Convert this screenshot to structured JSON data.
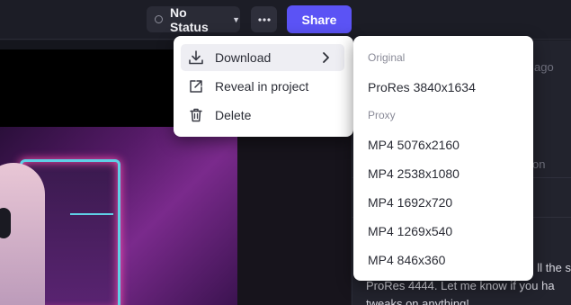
{
  "header": {
    "status_label": "No Status",
    "share_label": "Share"
  },
  "context_menu": {
    "items": [
      {
        "label": "Download",
        "icon": "download-icon"
      },
      {
        "label": "Reveal in project",
        "icon": "external-link-icon"
      },
      {
        "label": "Delete",
        "icon": "trash-icon"
      }
    ]
  },
  "download_submenu": {
    "original_heading": "Original",
    "original_items": [
      "ProRes 3840x1634"
    ],
    "proxy_heading": "Proxy",
    "proxy_items": [
      "MP4 5076x2160",
      "MP4 2538x1080",
      "MP4 1692x720",
      "MP4 1269x540",
      "MP4 846x360"
    ]
  },
  "side_panel": {
    "time_1": "ago",
    "time_2": "on",
    "comment_lines": [
      "ll the s",
      "ProRes 4444. Let me know if you ha",
      "tweaks on anything!"
    ]
  },
  "colors": {
    "accent": "#5b53f5",
    "topbar": "#1c1d26",
    "menu_bg": "#ffffff"
  }
}
